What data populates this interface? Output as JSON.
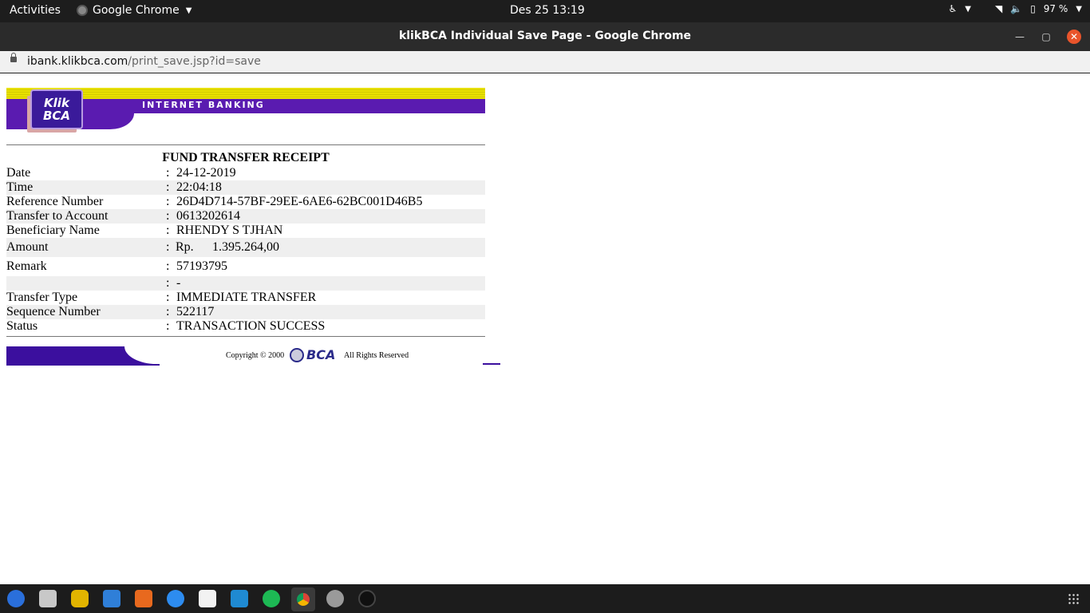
{
  "topbar": {
    "activities": "Activities",
    "app_name": "Google Chrome",
    "clock": "Des 25  13:19",
    "battery": "97 %"
  },
  "window": {
    "title": "klikBCA Individual Save Page - Google Chrome"
  },
  "address": {
    "host": "ibank.klikbca.com",
    "path": "/print_save.jsp?id=save"
  },
  "banner": {
    "brand_line1": "Klik",
    "brand_line2": "BCA",
    "heading": "INTERNET BANKING"
  },
  "receipt": {
    "title": "FUND TRANSFER RECEIPT",
    "rows": [
      {
        "label": "Date",
        "value": "24-12-2019"
      },
      {
        "label": "Time",
        "value": "22:04:18"
      },
      {
        "label": "Reference Number",
        "value": "26D4D714-57BF-29EE-6AE6-62BC001D46B5"
      },
      {
        "label": "Transfer to Account",
        "value": "0613202614"
      },
      {
        "label": "Beneficiary Name",
        "value": "RHENDY S TJHAN"
      },
      {
        "label": "Amount",
        "currency": "Rp.",
        "value": "1.395.264,00"
      },
      {
        "label": "Remark",
        "value": "57193795"
      },
      {
        "label": "",
        "value": "-"
      },
      {
        "label": "Transfer Type",
        "value": "IMMEDIATE TRANSFER"
      },
      {
        "label": "Sequence Number",
        "value": "522117"
      },
      {
        "label": "Status",
        "value": "TRANSACTION SUCCESS"
      }
    ],
    "separator": ":"
  },
  "footer": {
    "copyright": "Copyright © 2000",
    "logo_text": "BCA",
    "rights": "All Rights Reserved"
  },
  "dock": {
    "items": [
      "thunderbird-icon",
      "files-icon",
      "rhythmbox-icon",
      "libreoffice-writer-icon",
      "software-icon",
      "help-icon",
      "amazon-icon",
      "vscode-icon",
      "spotify-icon",
      "chrome-icon",
      "settings-icon",
      "app-icon"
    ]
  },
  "colors": {
    "brand_purple": "#5a1bb0",
    "banner_yellow": "#e8e100",
    "row_shade": "#efefef"
  }
}
